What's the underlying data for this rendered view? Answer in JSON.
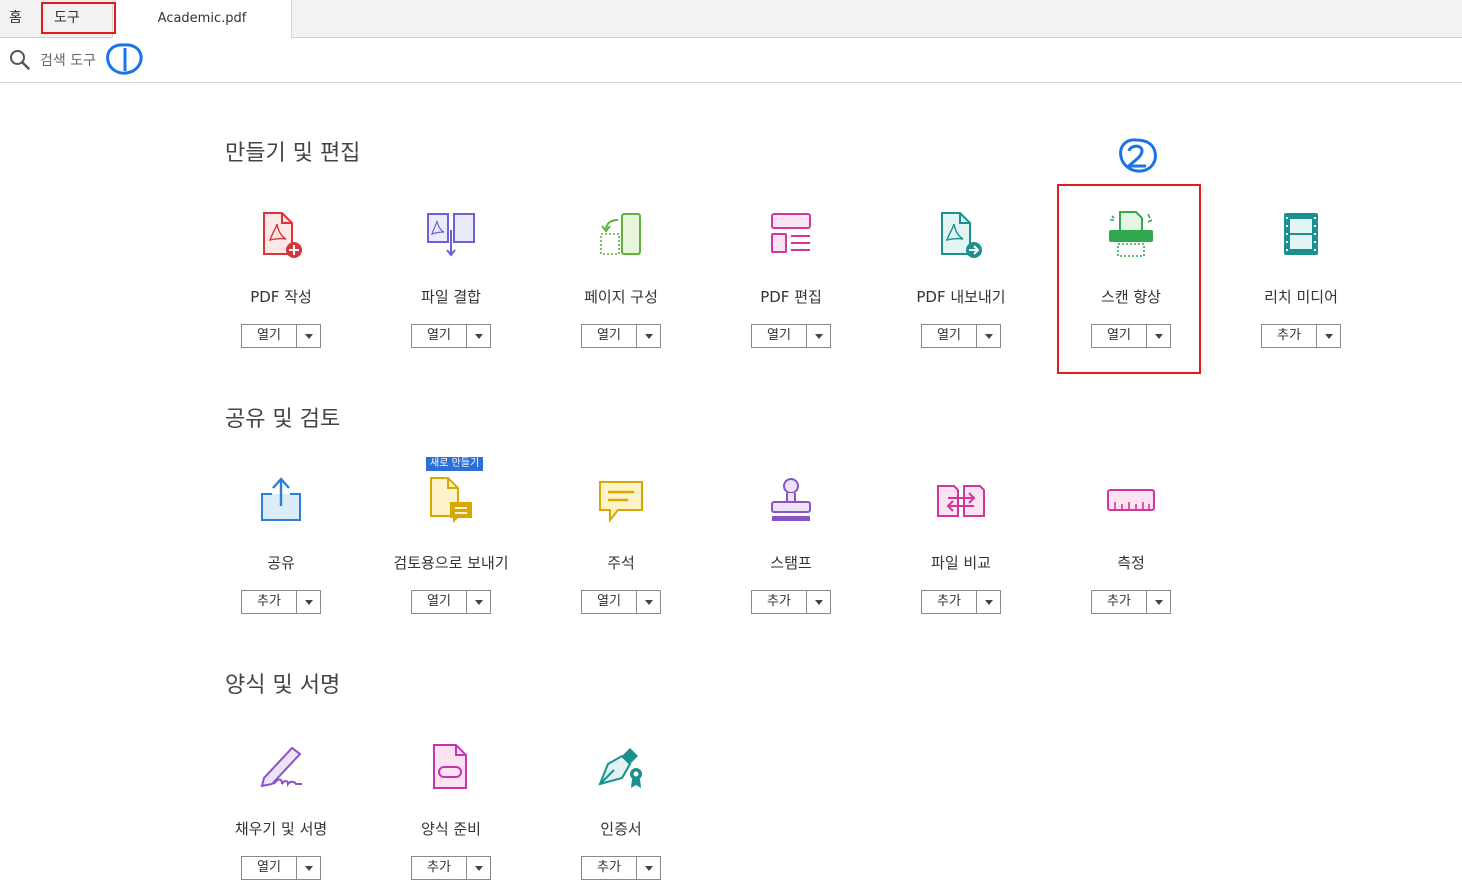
{
  "tabs": {
    "home": "홈",
    "tools": "도구",
    "document": "Academic.pdf"
  },
  "search": {
    "label": "검색 도구"
  },
  "sections": [
    {
      "title": "만들기 및 편집",
      "tools": [
        {
          "name": "PDF 작성",
          "button": "열기",
          "icon": "create-pdf-icon"
        },
        {
          "name": "파일 결합",
          "button": "열기",
          "icon": "combine-files-icon"
        },
        {
          "name": "페이지 구성",
          "button": "열기",
          "icon": "organize-pages-icon"
        },
        {
          "name": "PDF 편집",
          "button": "열기",
          "icon": "edit-pdf-icon"
        },
        {
          "name": "PDF 내보내기",
          "button": "열기",
          "icon": "export-pdf-icon"
        },
        {
          "name": "스캔 향상",
          "button": "열기",
          "icon": "enhance-scan-icon"
        },
        {
          "name": "리치 미디어",
          "button": "추가",
          "icon": "rich-media-icon"
        }
      ]
    },
    {
      "title": "공유 및 검토",
      "tools": [
        {
          "name": "공유",
          "button": "추가",
          "icon": "share-icon"
        },
        {
          "name": "검토용으로 보내기",
          "button": "열기",
          "icon": "send-for-review-icon",
          "badge": "새로 만들기"
        },
        {
          "name": "주석",
          "button": "열기",
          "icon": "comment-icon"
        },
        {
          "name": "스탬프",
          "button": "추가",
          "icon": "stamp-icon"
        },
        {
          "name": "파일 비교",
          "button": "추가",
          "icon": "compare-files-icon"
        },
        {
          "name": "측정",
          "button": "추가",
          "icon": "measure-icon"
        }
      ]
    },
    {
      "title": "양식 및 서명",
      "tools": [
        {
          "name": "채우기 및 서명",
          "button": "열기",
          "icon": "fill-sign-icon"
        },
        {
          "name": "양식 준비",
          "button": "추가",
          "icon": "prepare-form-icon"
        },
        {
          "name": "인증서",
          "button": "추가",
          "icon": "certificate-icon"
        }
      ]
    }
  ],
  "colors": {
    "highlight": "#e31b1b",
    "annotation": "#1a73e8",
    "badge": "#2d6fd6"
  }
}
